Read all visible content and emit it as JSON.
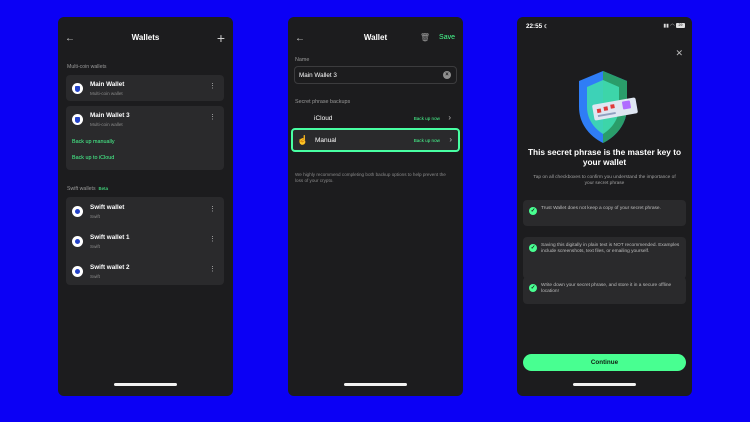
{
  "phone1": {
    "title": "Wallets",
    "back_icon": "‹",
    "add_icon": "+",
    "multi_section": "Multi-coin wallets",
    "wallets": [
      {
        "name": "Main Wallet",
        "sub": "Multi-coin wallet"
      },
      {
        "name": "Main Wallet 3",
        "sub": "Multi-coin wallet"
      }
    ],
    "backup_manual": "Back up manually",
    "backup_icloud": "Back up to iCloud",
    "swift_section": "Swift wallets",
    "swift_badge": "Beta",
    "swift_wallets": [
      {
        "name": "Swift wallet",
        "sub": "Swift"
      },
      {
        "name": "Swift wallet 1",
        "sub": "Swift"
      },
      {
        "name": "Swift wallet 2",
        "sub": "Swift"
      }
    ]
  },
  "phone2": {
    "title": "Wallet",
    "save": "Save",
    "name_label": "Name",
    "name_value": "Main Wallet 3",
    "backups_label": "Secret phrase backups",
    "backups": [
      {
        "name": "iCloud",
        "action": "Back up now"
      },
      {
        "name": "Manual",
        "action": "Back up now"
      }
    ],
    "note": "We highly recommend completing both backup options to help prevent the loss of your crypto."
  },
  "phone3": {
    "time": "22:55",
    "battery": "29",
    "title": "This secret phrase is the master key to your wallet",
    "subtitle": "Tap on all checkboxes to confirm you understand the importance of your secret phrase",
    "checks": [
      "Trust Wallet does not keep a copy of your secret phrase.",
      "Saving this digitally in plain text is NOT recommended. Examples include screenshots, text files, or emailing yourself.",
      "Write down your secret phrase, and store it in a secure offline location!"
    ],
    "continue": "Continue"
  },
  "colors": {
    "background": "#0b00f5",
    "accent": "#48ff91",
    "panel": "#1c1c1e",
    "card": "#2a2a2c"
  }
}
